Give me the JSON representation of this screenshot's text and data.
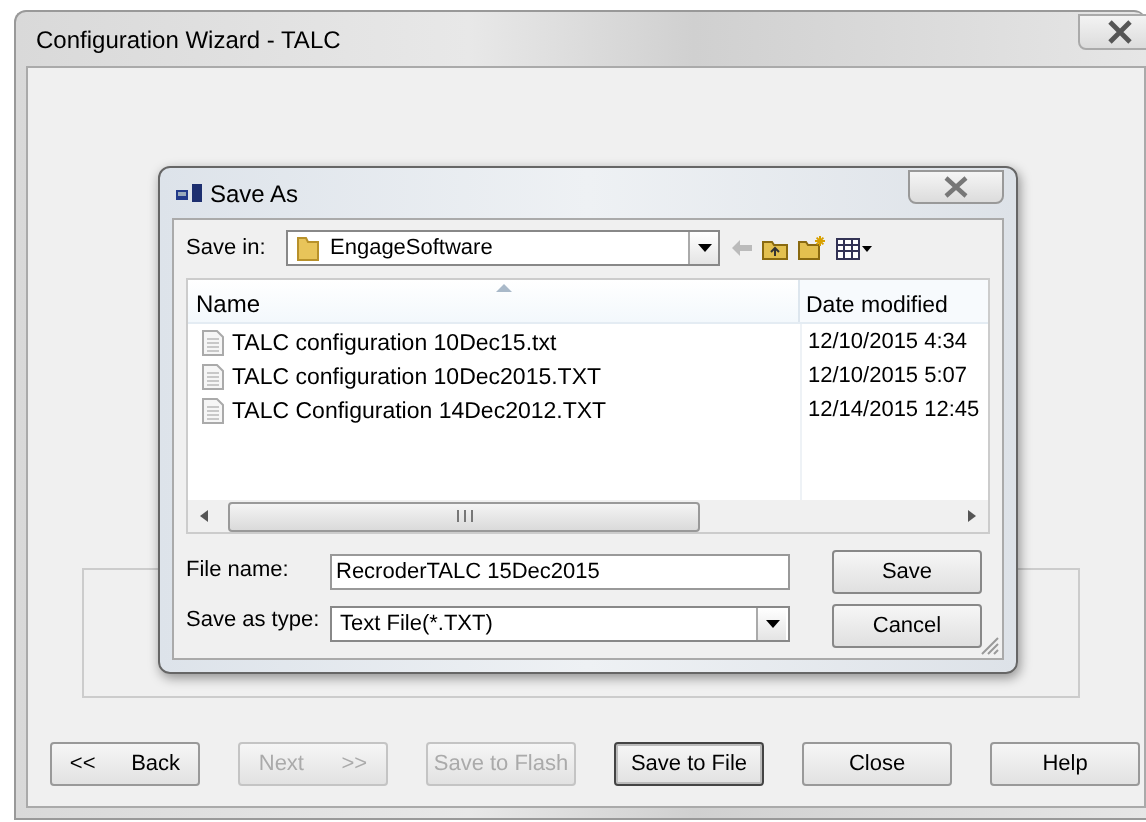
{
  "window": {
    "title": "Configuration Wizard - TALC"
  },
  "wizard_buttons": [
    {
      "label": "<<",
      "label_2": "Back",
      "disabled": false,
      "default": false
    },
    {
      "label": "Next",
      "label_2": ">>",
      "disabled": true,
      "default": false
    },
    {
      "label": "Save to Flash",
      "disabled": true,
      "default": false
    },
    {
      "label": "Save to File",
      "disabled": false,
      "default": true
    },
    {
      "label": "Close",
      "disabled": false,
      "default": false
    },
    {
      "label": "Help",
      "disabled": false,
      "default": false
    }
  ],
  "dialog": {
    "title": "Save As",
    "save_in": {
      "label": "Save in:",
      "value": "EngageSoftware"
    },
    "columns": [
      "Name",
      "Date modified"
    ],
    "files": [
      {
        "name": "TALC configuration 10Dec15.txt",
        "date_modified": "12/10/2015 4:34"
      },
      {
        "name": "TALC configuration 10Dec2015.TXT",
        "date_modified": "12/10/2015 5:07"
      },
      {
        "name": "TALC Configuration 14Dec2012.TXT",
        "date_modified": "12/14/2015 12:45"
      }
    ],
    "file_name": {
      "label": "File name:",
      "value": "RecroderTALC 15Dec2015"
    },
    "save_as_type": {
      "label": "Save as type:",
      "value": "Text File(*.TXT)"
    },
    "buttons": [
      {
        "label": "Save",
        "default": false
      },
      {
        "label": "Cancel",
        "default": false
      }
    ]
  }
}
